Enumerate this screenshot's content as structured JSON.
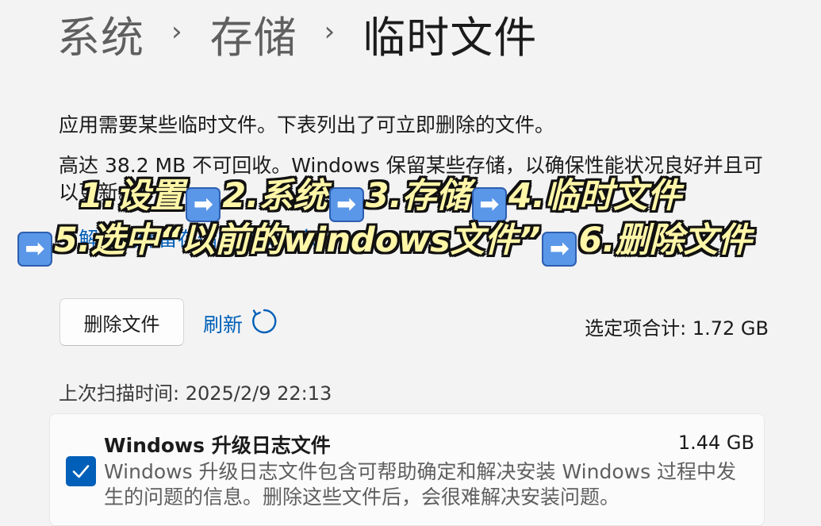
{
  "breadcrumb": {
    "item1": "系统",
    "item2": "存储",
    "current": "临时文件"
  },
  "intro": {
    "line1": "应用需要某些临时文件。下表列出了可立即删除的文件。",
    "line2": "高达 38.2 MB 不可回收。Windows 保留某些存储，以确保性能状况良好并且可以更新。",
    "link": "了解有关保留存储的更多信息"
  },
  "overlay": {
    "step1": "1.设置",
    "step2": "2.系统",
    "step3": "3.存储",
    "step4": "4.临时文件",
    "step5": "5.选中“以前的windows文件”",
    "step6": "6.删除文件",
    "arrow_glyph": "➡"
  },
  "actions": {
    "delete_label": "删除文件",
    "refresh_label": "刷新",
    "total_label": "选定项合计: 1.72 GB"
  },
  "last_scan": "上次扫描时间: 2025/2/9 22:13",
  "items": [
    {
      "title": "Windows 升级日志文件",
      "size": "1.44 GB",
      "description": "Windows 升级日志文件包含可帮助确定和解决安装 Windows 过程中发生的问题的信息。删除这些文件后，会很难解决安装问题。",
      "checked": true
    }
  ],
  "colors": {
    "accent": "#005fb8",
    "background": "#f3f3f3",
    "overlay_text": "#fff6a8"
  }
}
